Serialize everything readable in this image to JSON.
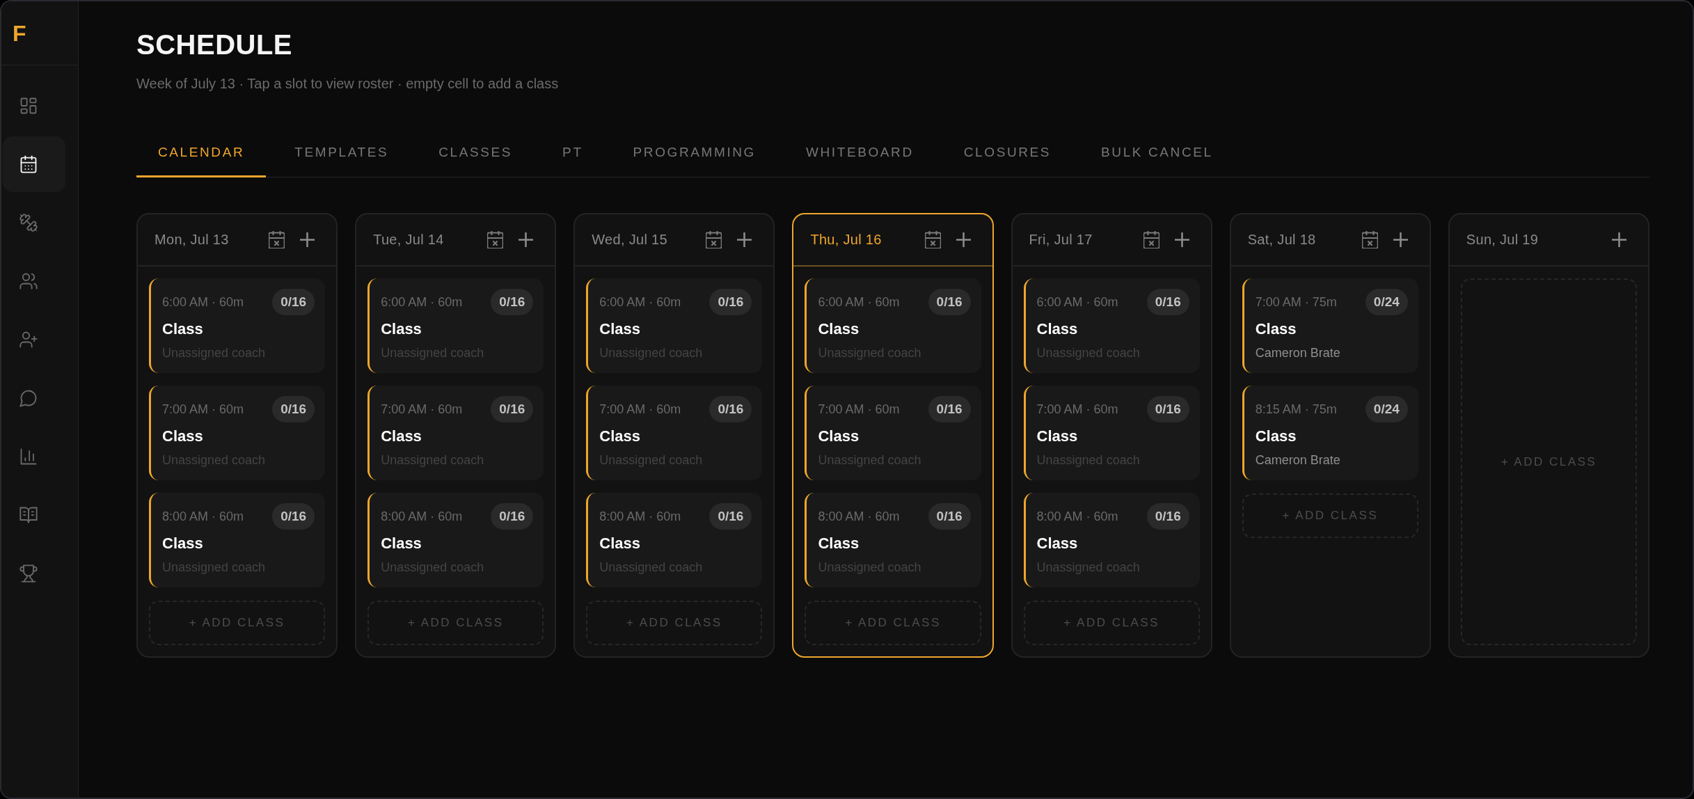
{
  "sidebar": {
    "logo": "F",
    "items": [
      {
        "selected": false
      },
      {
        "selected": true
      },
      {
        "selected": false
      },
      {
        "selected": false
      },
      {
        "selected": false
      },
      {
        "selected": false
      },
      {
        "selected": false
      },
      {
        "selected": false
      },
      {
        "selected": false
      }
    ]
  },
  "header": {
    "title": "SCHEDULE",
    "subtitle": "Week of July 13 · Tap a slot to view roster · empty cell to add a class"
  },
  "tabs": [
    {
      "label": "CALENDAR",
      "selected": true
    },
    {
      "label": "TEMPLATES",
      "selected": false
    },
    {
      "label": "CLASSES",
      "selected": false
    },
    {
      "label": "PT",
      "selected": false
    },
    {
      "label": "PROGRAMMING",
      "selected": false
    },
    {
      "label": "WHITEBOARD",
      "selected": false
    },
    {
      "label": "CLOSURES",
      "selected": false
    },
    {
      "label": "BULK CANCEL",
      "selected": false
    }
  ],
  "days": [
    {
      "label": "Mon, Jul 13",
      "selected": false,
      "closable": true,
      "classes": [
        {
          "time": "6:00 AM · 60m",
          "booked": "0/16",
          "title": "Class",
          "coach": "Unassigned coach",
          "assigned": false
        },
        {
          "time": "7:00 AM · 60m",
          "booked": "0/16",
          "title": "Class",
          "coach": "Unassigned coach",
          "assigned": false
        },
        {
          "time": "8:00 AM · 60m",
          "booked": "0/16",
          "title": "Class",
          "coach": "Unassigned coach",
          "assigned": false
        }
      ],
      "add_label": "+ ADD CLASS"
    },
    {
      "label": "Tue, Jul 14",
      "selected": false,
      "closable": true,
      "classes": [
        {
          "time": "6:00 AM · 60m",
          "booked": "0/16",
          "title": "Class",
          "coach": "Unassigned coach",
          "assigned": false
        },
        {
          "time": "7:00 AM · 60m",
          "booked": "0/16",
          "title": "Class",
          "coach": "Unassigned coach",
          "assigned": false
        },
        {
          "time": "8:00 AM · 60m",
          "booked": "0/16",
          "title": "Class",
          "coach": "Unassigned coach",
          "assigned": false
        }
      ],
      "add_label": "+ ADD CLASS"
    },
    {
      "label": "Wed, Jul 15",
      "selected": false,
      "closable": true,
      "classes": [
        {
          "time": "6:00 AM · 60m",
          "booked": "0/16",
          "title": "Class",
          "coach": "Unassigned coach",
          "assigned": false
        },
        {
          "time": "7:00 AM · 60m",
          "booked": "0/16",
          "title": "Class",
          "coach": "Unassigned coach",
          "assigned": false
        },
        {
          "time": "8:00 AM · 60m",
          "booked": "0/16",
          "title": "Class",
          "coach": "Unassigned coach",
          "assigned": false
        }
      ],
      "add_label": "+ ADD CLASS"
    },
    {
      "label": "Thu, Jul 16",
      "selected": true,
      "closable": true,
      "classes": [
        {
          "time": "6:00 AM · 60m",
          "booked": "0/16",
          "title": "Class",
          "coach": "Unassigned coach",
          "assigned": false
        },
        {
          "time": "7:00 AM · 60m",
          "booked": "0/16",
          "title": "Class",
          "coach": "Unassigned coach",
          "assigned": false
        },
        {
          "time": "8:00 AM · 60m",
          "booked": "0/16",
          "title": "Class",
          "coach": "Unassigned coach",
          "assigned": false
        }
      ],
      "add_label": "+ ADD CLASS"
    },
    {
      "label": "Fri, Jul 17",
      "selected": false,
      "closable": true,
      "classes": [
        {
          "time": "6:00 AM · 60m",
          "booked": "0/16",
          "title": "Class",
          "coach": "Unassigned coach",
          "assigned": false
        },
        {
          "time": "7:00 AM · 60m",
          "booked": "0/16",
          "title": "Class",
          "coach": "Unassigned coach",
          "assigned": false
        },
        {
          "time": "8:00 AM · 60m",
          "booked": "0/16",
          "title": "Class",
          "coach": "Unassigned coach",
          "assigned": false
        }
      ],
      "add_label": "+ ADD CLASS"
    },
    {
      "label": "Sat, Jul 18",
      "selected": false,
      "closable": true,
      "classes": [
        {
          "time": "7:00 AM · 75m",
          "booked": "0/24",
          "title": "Class",
          "coach": "Cameron Brate",
          "assigned": true
        },
        {
          "time": "8:15 AM · 75m",
          "booked": "0/24",
          "title": "Class",
          "coach": "Cameron Brate",
          "assigned": true
        }
      ],
      "add_label": "+ ADD CLASS"
    },
    {
      "label": "Sun, Jul 19",
      "selected": false,
      "closable": false,
      "add_label": "+ ADD CLASS"
    }
  ]
}
